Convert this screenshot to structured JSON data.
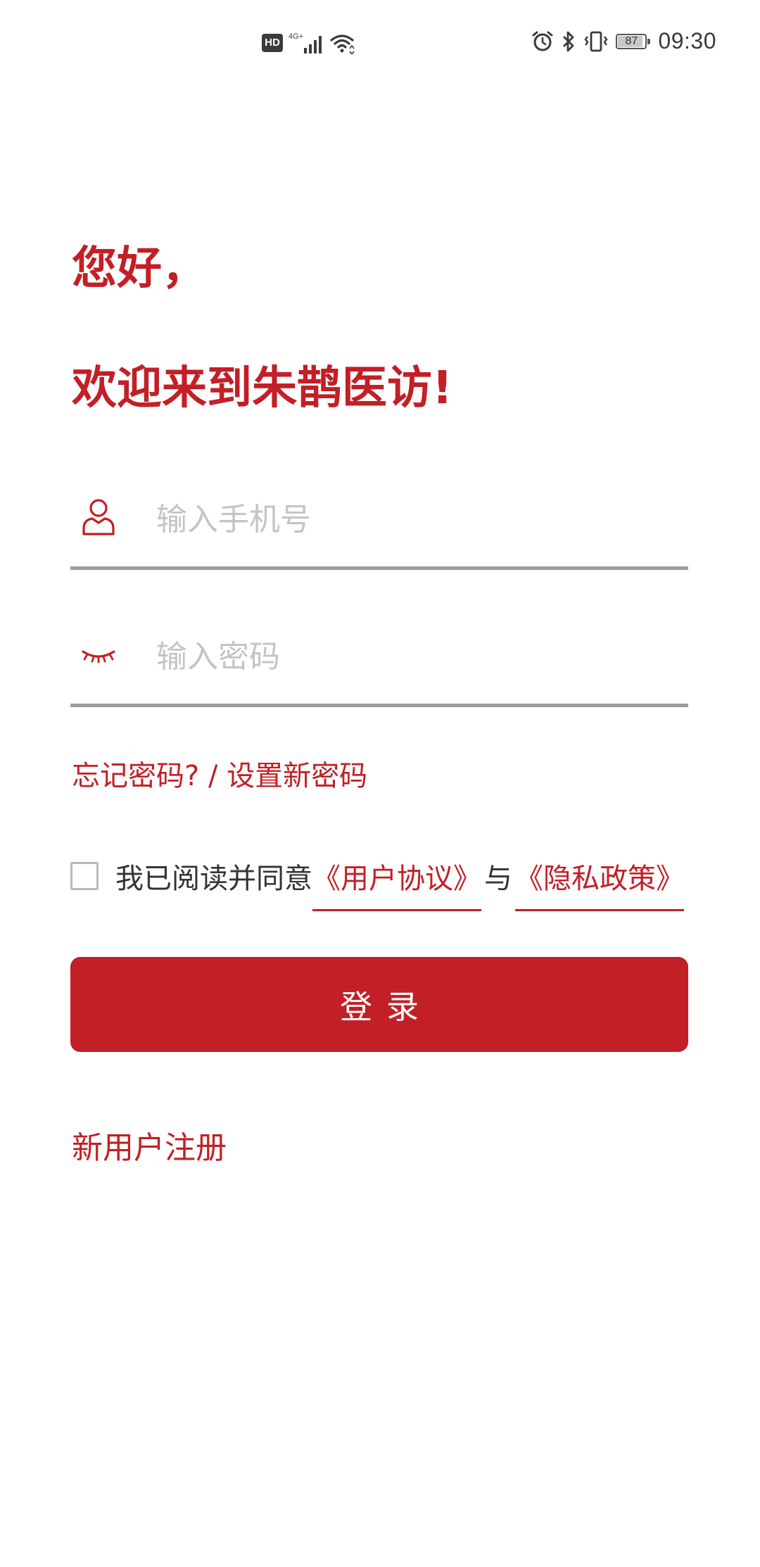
{
  "status_bar": {
    "hd": "HD",
    "network": "4G+",
    "battery": "87",
    "battery_level": 0.87,
    "time": "09:30"
  },
  "greeting": {
    "line1": "您好，",
    "line2": "欢迎来到朱鹊医访!"
  },
  "phone_field": {
    "placeholder": "输入手机号",
    "icon": "user-icon"
  },
  "password_field": {
    "placeholder": "输入密码",
    "icon": "eye-closed-icon"
  },
  "forgot_link": "忘记密码? / 设置新密码",
  "agreement": {
    "prefix": "我已阅读并同意",
    "user_agreement": "《用户协议》",
    "and": "与",
    "privacy_policy": "《隐私政策》",
    "checked": false
  },
  "login_button": "登录",
  "register_link": "新用户注册",
  "colors": {
    "brand": "#c21f26",
    "divider": "#9b9b9b",
    "placeholder": "#c4c4c4"
  }
}
